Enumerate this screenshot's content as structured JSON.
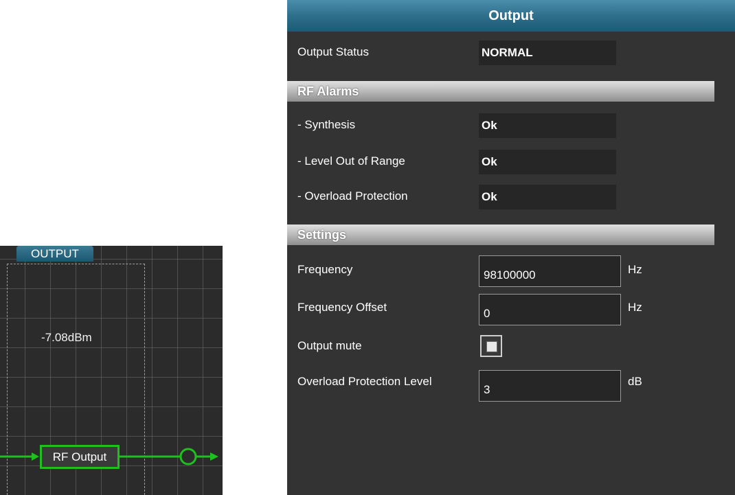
{
  "diagram": {
    "tab_label": "OUTPUT",
    "level_readout": "-7.08dBm",
    "block_label": "RF Output",
    "wire_color": "#1fbf1f"
  },
  "panel": {
    "title": "Output",
    "output_status": {
      "label": "Output Status",
      "value": "NORMAL"
    },
    "rf_alarms": {
      "heading": "RF Alarms",
      "items": [
        {
          "label": "- Synthesis",
          "value": "Ok"
        },
        {
          "label": "- Level Out of Range",
          "value": "Ok"
        },
        {
          "label": "- Overload Protection",
          "value": "Ok"
        }
      ]
    },
    "settings": {
      "heading": "Settings",
      "frequency": {
        "label": "Frequency",
        "value": "98100000",
        "unit": "Hz"
      },
      "frequency_offset": {
        "label": "Frequency Offset",
        "value": "0",
        "unit": "Hz"
      },
      "output_mute": {
        "label": "Output mute",
        "checked": false
      },
      "overload_protection_level": {
        "label": "Overload Protection Level",
        "value": "3",
        "unit": "dB"
      }
    }
  },
  "colors": {
    "header_blue": "#2e6f8c",
    "panel_bg": "#333333",
    "signal_green": "#1fbf1f"
  }
}
